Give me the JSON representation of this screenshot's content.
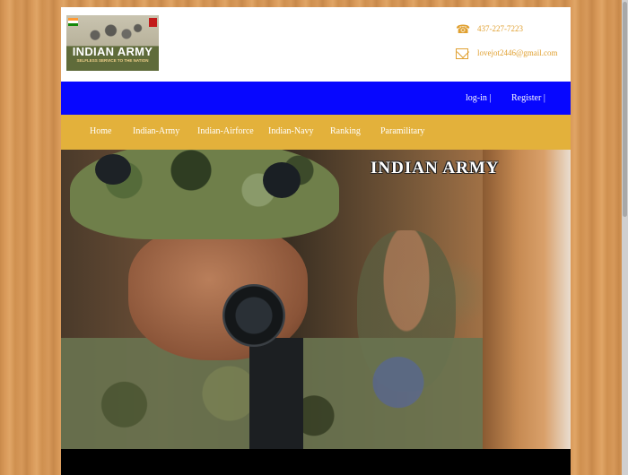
{
  "header": {
    "logo": {
      "title": "INDIAN ARMY",
      "tagline": "SELFLESS SERVICE TO THE NATION",
      "flag_colors": [
        "#ff9933",
        "#ffffff",
        "#138808"
      ]
    },
    "contact": {
      "phone": "437-227-7223",
      "email": "lovejot2446@gmail.com",
      "phone_icon": "phone-icon",
      "email_icon": "envelope-icon"
    }
  },
  "topbar": {
    "login_label": "log-in |",
    "register_label": "Register |",
    "color": "#0707ff"
  },
  "nav": {
    "color": "#e3b13b",
    "items": [
      "Home",
      "Indian-Army",
      "Indian-Airforce",
      "Indian-Navy",
      "Ranking",
      "Paramilitary"
    ]
  },
  "hero": {
    "caption": "INDIAN ARMY"
  }
}
